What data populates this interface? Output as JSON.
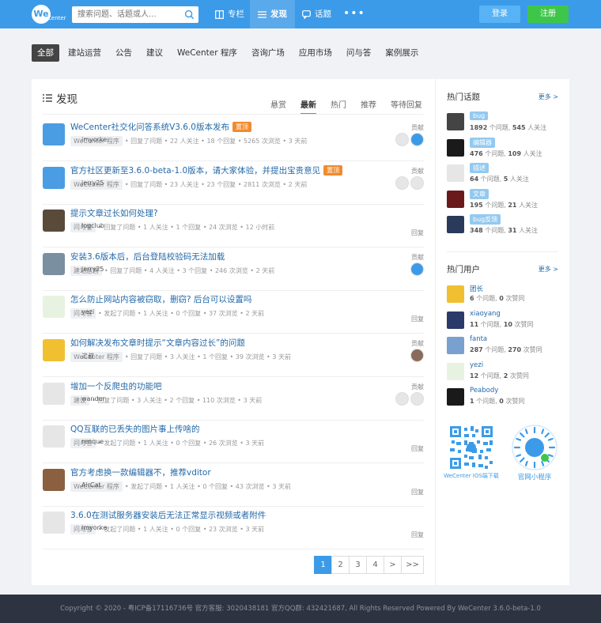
{
  "header": {
    "logo_text": "We",
    "logo_sub": "Center",
    "search_placeholder": "搜索问题、话题或人...",
    "nav": [
      {
        "label": "专栏",
        "icon": "columns-icon"
      },
      {
        "label": "发现",
        "icon": "list-icon"
      },
      {
        "label": "话题",
        "icon": "chat-icon"
      }
    ],
    "more": "•••",
    "login": "登录",
    "register": "注册"
  },
  "categories": [
    "全部",
    "建站运营",
    "公告",
    "建议",
    "WeCenter 程序",
    "咨询广场",
    "应用市场",
    "问与答",
    "案例展示"
  ],
  "main": {
    "title": "发现",
    "tabs": [
      "悬赏",
      "最新",
      "热门",
      "推荐",
      "等待回复"
    ],
    "questions": [
      {
        "title": "WeCenter社交化问答系统V3.6.0版本发布",
        "pinned": "置顶",
        "tag": "WeCenter 程序",
        "user": "imyorke",
        "action": "回复了问题",
        "stats": "22 人关注 • 18 个回复 • 5265 次浏览 • 3 天前",
        "side": "贡献"
      },
      {
        "title": "官方社区更新至3.6.0-beta-1.0版本，请大家体验，并提出宝贵意见",
        "pinned": "置顶",
        "tag": "WeCenter 程序",
        "user": "jerry25",
        "action": "回复了问题",
        "stats": "23 人关注 • 23 个回复 • 2811 次浏览 • 2 天前",
        "side": "贡献"
      },
      {
        "title": "提示文章过长如何处理?",
        "pinned": "",
        "tag": "问与答",
        "user": "logclub",
        "action": "回复了问题",
        "stats": "1 人关注 • 1 个回复 • 24 次浏览 • 12 小时前",
        "side": "回复"
      },
      {
        "title": "安装3.6版本后，后台登陆校验码无法加载",
        "pinned": "",
        "tag": "建站运营",
        "user": "jerry25",
        "action": "回复了问题",
        "stats": "4 人关注 • 3 个回复 • 246 次浏览 • 2 天前",
        "side": "贡献"
      },
      {
        "title": "怎么防止网站内容被窃取，删窃? 后台可以设置吗",
        "pinned": "",
        "tag": "问与答",
        "user": "yezi",
        "action": "发起了问题",
        "stats": "1 人关注 • 0 个回复 • 37 次浏览 • 2 天前",
        "side": "回复"
      },
      {
        "title": "如何解决发布文章时提示“文章内容过长”的问题",
        "pinned": "",
        "tag": "WeCenter 程序",
        "user": "三叔",
        "action": "回复了问题",
        "stats": "3 人关注 • 1 个回复 • 39 次浏览 • 3 天前",
        "side": "贡献"
      },
      {
        "title": "增加一个反爬虫的功能吧",
        "pinned": "",
        "tag": "建议",
        "user": "wander",
        "action": "回复了问题",
        "stats": "3 人关注 • 2 个回复 • 110 次浏览 • 3 天前",
        "side": "贡献"
      },
      {
        "title": "QQ互联的已丢失的图片事上传啥的",
        "pinned": "",
        "tag": "问与答",
        "user": "renque",
        "action": "发起了问题",
        "stats": "1 人关注 • 0 个回复 • 26 次浏览 • 3 天前",
        "side": "回复"
      },
      {
        "title": "官方考虑换一款编辑器不，推荐vditor",
        "pinned": "",
        "tag": "WeCenter 程序",
        "user": "AirCat",
        "action": "发起了问题",
        "stats": "1 人关注 • 0 个回复 • 43 次浏览 • 3 天前",
        "side": "回复"
      },
      {
        "title": "3.6.0在测试服务器安装后无法正常显示视频或者附件",
        "pinned": "",
        "tag": "问与答",
        "user": "imyorke",
        "action": "发起了问题",
        "stats": "1 人关注 • 0 个回复 • 23 次浏览 • 3 天前",
        "side": "回复"
      }
    ],
    "pager": [
      "1",
      "2",
      "3",
      "4",
      ">",
      ">>"
    ]
  },
  "sidebar": {
    "hot_topics_title": "热门话题",
    "more": "更多 >",
    "topics": [
      {
        "name": "bug",
        "stat_a": "1892",
        "stat_b": "545"
      },
      {
        "name": "编辑器",
        "stat_a": "476",
        "stat_b": "109"
      },
      {
        "name": "描述",
        "stat_a": "64",
        "stat_b": "5"
      },
      {
        "name": "文章",
        "stat_a": "195",
        "stat_b": "21"
      },
      {
        "name": "bug反馈",
        "stat_a": "348",
        "stat_b": "31"
      }
    ],
    "topic_unit_a": " 个问题, ",
    "topic_unit_b": " 人关注",
    "hot_users_title": "热门用户",
    "users": [
      {
        "name": "团长",
        "q": "6",
        "v": "0"
      },
      {
        "name": "xiaoyang",
        "q": "11",
        "v": "10"
      },
      {
        "name": "fanta",
        "q": "287",
        "v": "270"
      },
      {
        "name": "yezi",
        "q": "12",
        "v": "2"
      },
      {
        "name": "Peabody",
        "q": "1",
        "v": "0"
      }
    ],
    "user_unit_a": " 个问题, ",
    "user_unit_b": " 次赞同",
    "qr_app": "WeCenter IOS端下载",
    "qr_mini": "官网小程序"
  },
  "footer": {
    "text": "Copyright © 2020 - 粤ICP备17116736号 官方客服: 3020438181 官方QQ群: 432421687, All Rights Reserved Powered By WeCenter 3.6.0-beta-1.0"
  },
  "colors": {
    "primary": "#3c9be8",
    "accent": "#3ec64a",
    "pin": "#f08b2e",
    "link": "#2469a8"
  }
}
